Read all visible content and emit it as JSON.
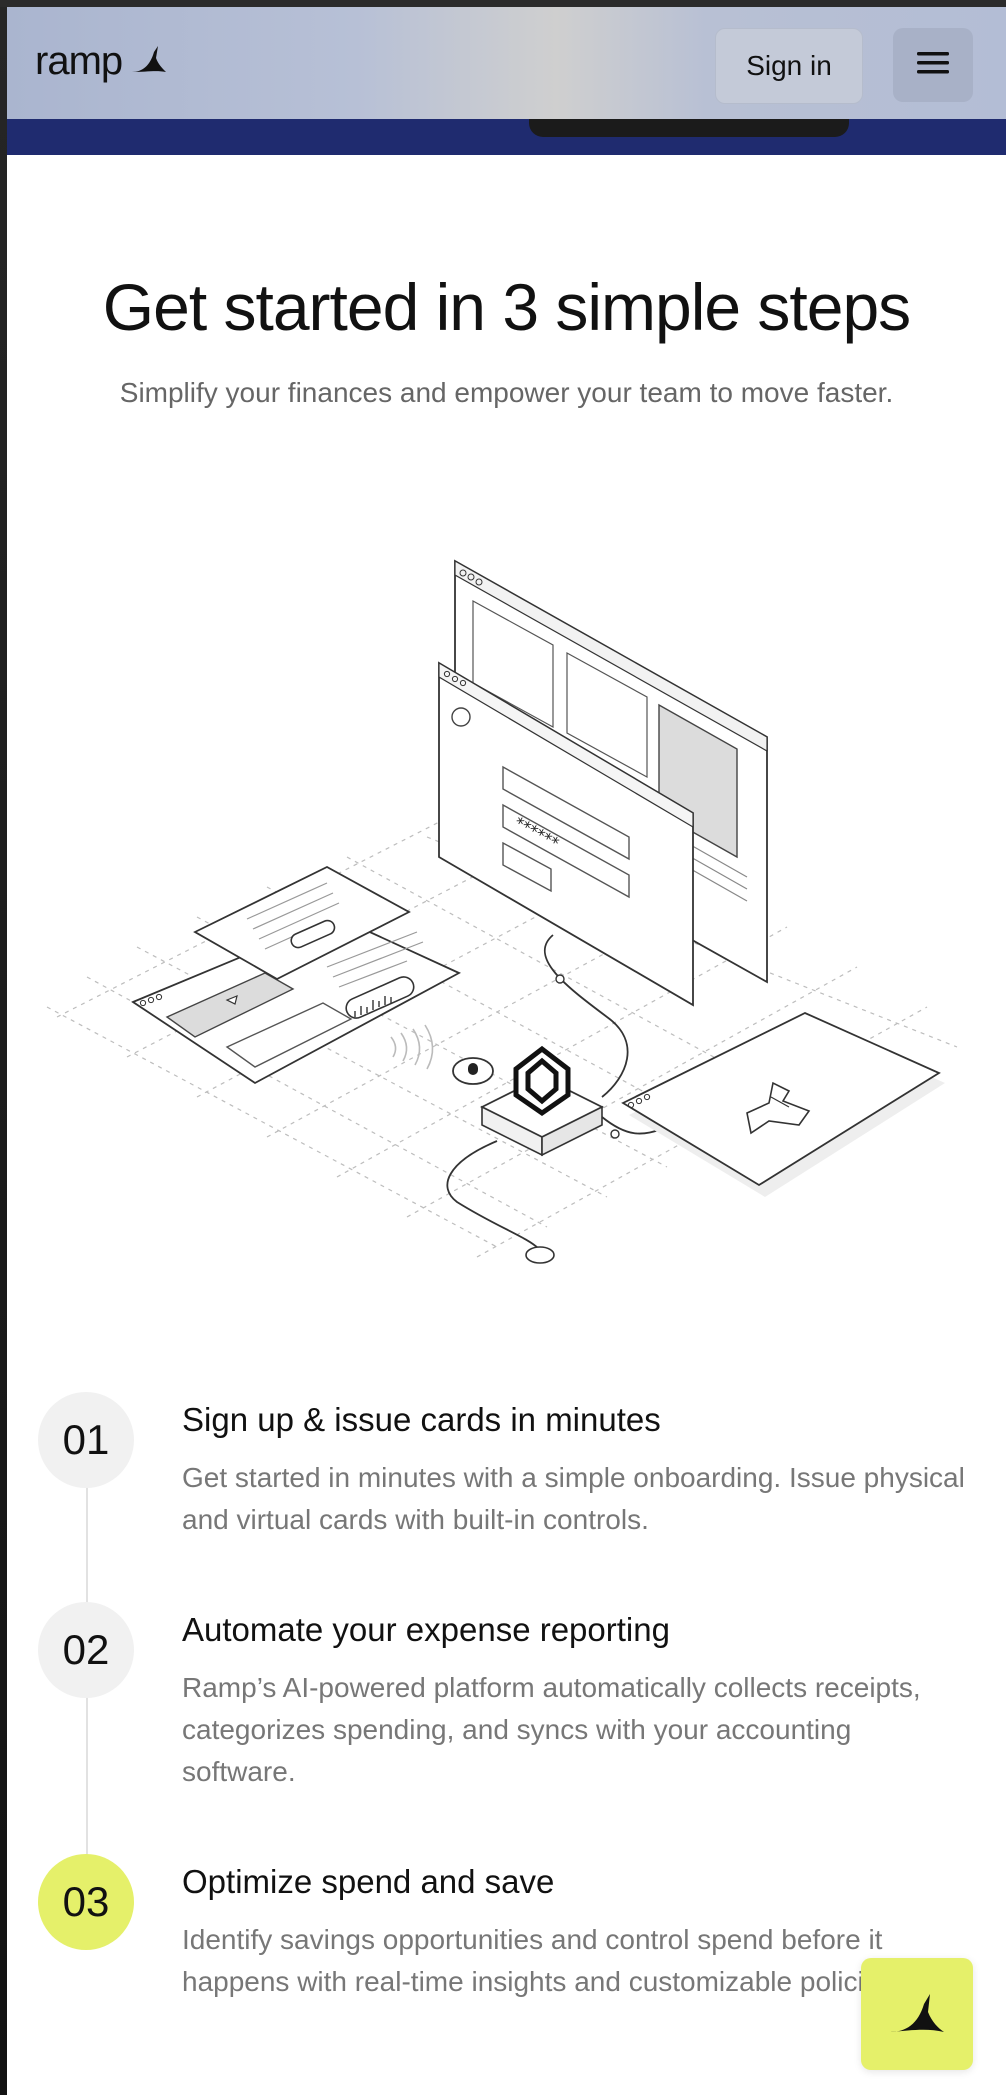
{
  "header": {
    "logo_text": "ramp",
    "signin_label": "Sign in"
  },
  "hero": {
    "title": "Get started in 3 simple steps",
    "subtitle": "Simplify your finances and empower your team to move faster."
  },
  "steps": [
    {
      "number": "01",
      "title": "Sign up & issue cards in minutes",
      "description": "Get started in minutes with a simple onboarding. Issue physical and virtual cards with built-in controls."
    },
    {
      "number": "02",
      "title": "Automate your expense reporting",
      "description": "Ramp’s AI-powered platform automatically collects receipts, categorizes spending, and syncs with your accounting software."
    },
    {
      "number": "03",
      "title": "Optimize spend and save",
      "description": "Identify savings opportunities and control spend before it happens with real-time insights and customizable policies."
    }
  ],
  "icons": {
    "logo": "ramp-logo-icon",
    "menu": "hamburger-menu-icon",
    "fab": "ramp-chat-icon"
  },
  "colors": {
    "accent": "#e5f06a",
    "hero_band": "#1f2b6f",
    "text_primary": "#111111",
    "text_secondary": "#777777"
  }
}
